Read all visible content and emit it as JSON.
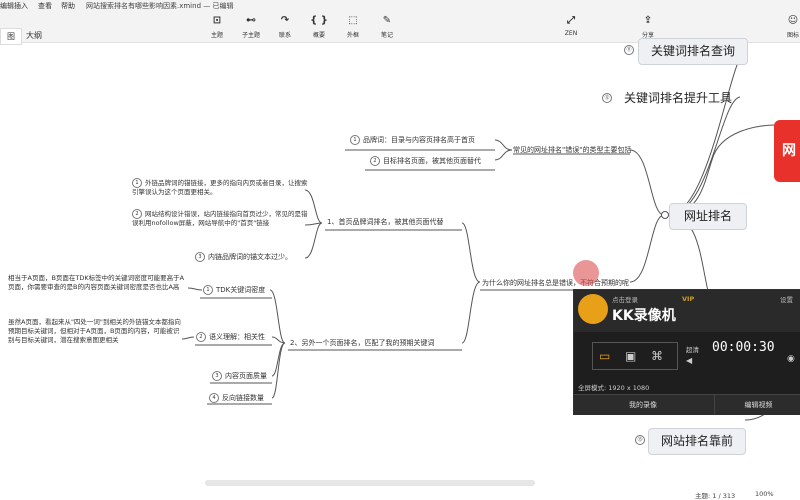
{
  "menu": [
    "编辑",
    "插入",
    "查看",
    "帮助"
  ],
  "filename": "网站搜索排名有哪些影响因素.xmind — 已编辑",
  "toolbar": {
    "topic": "主题",
    "subtopic": "子主题",
    "relation": "联系",
    "summary": "概要",
    "boundary": "外框",
    "note": "笔记",
    "zen": "ZEN",
    "share": "分享",
    "icon": "图标"
  },
  "view_tabs": {
    "map": "图",
    "outline": "大纲"
  },
  "nodes": {
    "search_rank_query": "关键词排名查询",
    "rank_tools": "关键词排名提升工具",
    "url_rank": "网址排名",
    "site_rank_front": "网站排名靠前",
    "num_query": "⑪",
    "num_tools": "⑫",
    "num_front": "⑬",
    "red_node": "网"
  },
  "branch": {
    "common_errors": "常见的网址排名\"错误\"的类型主要包括",
    "brand_word": "品牌词：目录与内容页排名高于首页",
    "target_page": "目标排名页面，被其他页面替代",
    "why_not": "为什么你的网址排名总是错误，不符合预期的呢",
    "sub1": "1、首页品牌词排名，被其他页面代替",
    "sub1_a": "外链品牌词的锚链接，更多的指向内页或者目录，让搜索引擎误认为这个页面更相关。",
    "sub1_b": "网站结构设计错误，站内链接指向首页过少，常见的是错误利用nofollow屏蔽，网站导航中的\"首页\"链接",
    "sub1_c": "内链品牌词的锚文本过少。",
    "sub2": "2、另外一个页面排名，匹配了我的预期关键词",
    "tdk": "TDK关键词密度",
    "tdk_note": "相当于A页面，B页面在TDK标签中的关键词密度可能要高于A页面，你需要审查的是B的内容页面关键词密度是否也比A高",
    "semantic": "语义理解：相关性",
    "semantic_note": "虽然A页面，看起来从\"四处一词\"到相关的外链锚文本都指向预期目标关键词，但相对于A页面，B页面的内容，可能被识别与目标关键词，潜在搜索意图更相关",
    "content_quality": "内容页面质量",
    "backlinks": "反向链接数量"
  },
  "kk": {
    "login": "点击登录",
    "vip": "VIP",
    "settings": "设置",
    "title": "KK录像机",
    "hd": "超清",
    "timer": "00:00:30",
    "fullscreen": "全屏模式: 1920 x 1080",
    "my_recordings": "我的录像",
    "edit_video": "编辑视频"
  },
  "status": {
    "pages": "主题: 1 / 313",
    "zoom": "100%"
  }
}
